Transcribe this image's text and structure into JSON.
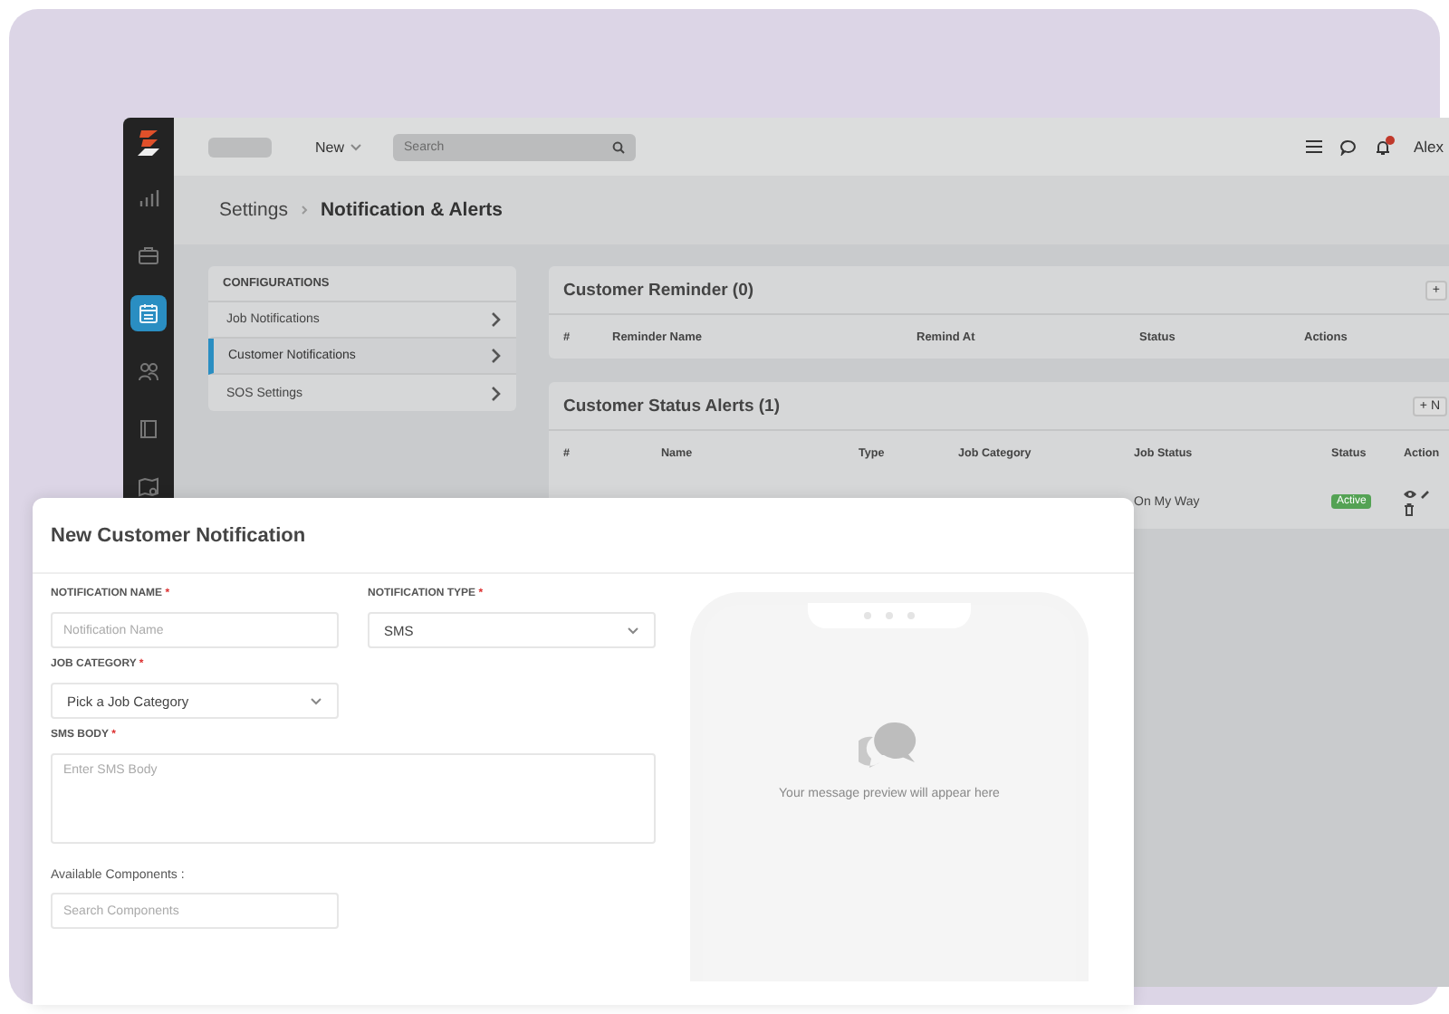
{
  "topbar": {
    "new_menu": "New",
    "search": {
      "placeholder": "Search"
    },
    "user": "Alex"
  },
  "nav": [
    {
      "selected": false
    },
    {
      "selected": false
    },
    {
      "selected": true
    },
    {
      "selected": false
    },
    {
      "selected": false
    },
    {
      "selected": false
    }
  ],
  "breadcrumb": [
    "Settings",
    "Notification & Alerts"
  ],
  "configurations": {
    "title": "CONFIGURATIONS",
    "items": [
      {
        "label": "Job Notifications",
        "selected": false
      },
      {
        "label": "Customer Notifications",
        "selected": true
      },
      {
        "label": "SOS Settings",
        "selected": false
      }
    ]
  },
  "reminder": {
    "title": "Customer Reminder (0)",
    "add_label": "+",
    "columns": [
      "#",
      "Reminder Name",
      "Remind At",
      "Status",
      "Actions"
    ]
  },
  "alerts": {
    "title": "Customer Status Alerts (1)",
    "add_label": "+ N",
    "columns": [
      "#",
      "Name",
      "Type",
      "Job Category",
      "Job Status",
      "Status",
      "Action"
    ],
    "rows": [
      {
        "job_status": "On My Way",
        "status": "Active"
      }
    ]
  },
  "modal": {
    "title": "New Customer Notification",
    "fields": [
      {
        "kind": "input",
        "label": "NOTIFICATION NAME",
        "mark": "*",
        "placeholder": "Notification Name"
      },
      {
        "kind": "select",
        "label": "NOTIFICATION TYPE",
        "mark": "*",
        "value": "SMS"
      },
      {
        "kind": "select",
        "label": "JOB CATEGORY",
        "mark": "*",
        "value": "Pick a Job Category"
      },
      {
        "kind": "textarea",
        "label": "SMS BODY",
        "mark": "*",
        "placeholder": "Enter SMS Body"
      }
    ],
    "components": {
      "label": "Available Components :",
      "placeholder": "Search Components"
    },
    "preview": {
      "text": "Your message preview will appear here"
    }
  }
}
